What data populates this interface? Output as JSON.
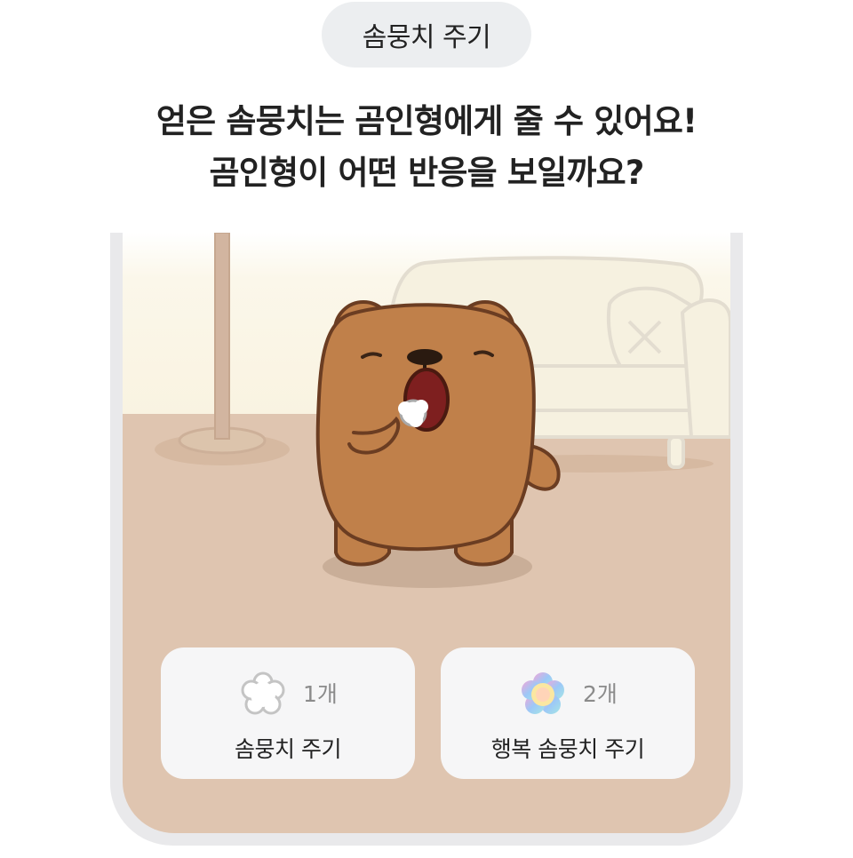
{
  "header": {
    "pill_label": "솜뭉치 주기",
    "headline_line1": "얻은 솜뭉치는 곰인형에게 줄 수 있어요!",
    "headline_line2": "곰인형이 어떤 반응을 보일까요?"
  },
  "actions": [
    {
      "count": "1개",
      "label": "솜뭉치 주기",
      "icon": "cotton-ball-icon"
    },
    {
      "count": "2개",
      "label": "행복 솜뭉치 주기",
      "icon": "rainbow-cotton-ball-icon"
    }
  ],
  "colors": {
    "floor": "#dfc5b0",
    "wall": "#fbf7ea",
    "bear_fur": "#c0804a",
    "bear_outline": "#6b3d22",
    "card_bg": "#f6f6f7",
    "pill_bg": "#eceef0"
  }
}
